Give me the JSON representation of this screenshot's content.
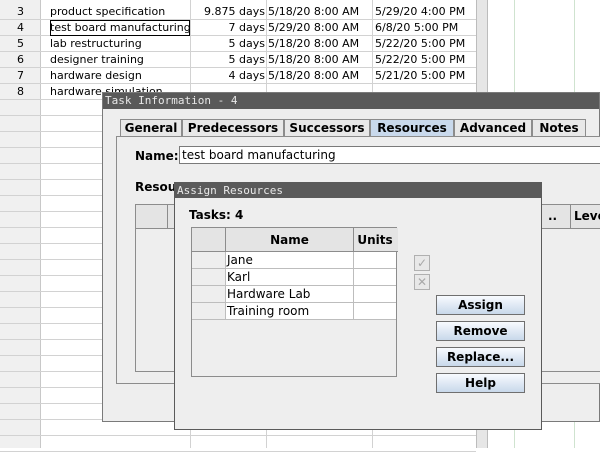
{
  "task_table": {
    "rows": [
      {
        "num": "3",
        "name": "product specification",
        "duration": "9.875 days",
        "start": "5/18/20 8:00 AM",
        "finish": "5/29/20 4:00 PM"
      },
      {
        "num": "4",
        "name": "test board manufacturing",
        "duration": "7 days",
        "start": "5/29/20 8:00 AM",
        "finish": "6/8/20 5:00 PM"
      },
      {
        "num": "5",
        "name": "lab restructuring",
        "duration": "5 days",
        "start": "5/18/20 8:00 AM",
        "finish": "5/22/20 5:00 PM"
      },
      {
        "num": "6",
        "name": "designer training",
        "duration": "5 days",
        "start": "5/18/20 8:00 AM",
        "finish": "5/22/20 5:00 PM"
      },
      {
        "num": "7",
        "name": "hardware design",
        "duration": "4 days",
        "start": "5/18/20 8:00 AM",
        "finish": "5/21/20 5:00 PM"
      },
      {
        "num": "8",
        "name": "hardware simulation",
        "duration": "",
        "start": "",
        "finish": ""
      }
    ]
  },
  "task_info_dialog": {
    "title": "Task Information - 4",
    "tabs": [
      {
        "label": "General"
      },
      {
        "label": "Predecessors"
      },
      {
        "label": "Successors"
      },
      {
        "label": "Resources"
      },
      {
        "label": "Advanced"
      },
      {
        "label": "Notes"
      }
    ],
    "active_tab": "Resources",
    "name_label": "Name:",
    "name_value": "test board manufacturing",
    "resources_label": "Resou",
    "table_header_partial": "..",
    "table_header_leveling": "Leveli"
  },
  "assign_dialog": {
    "title": "Assign Resources",
    "tasks_label": "Tasks: 4",
    "columns": {
      "name": "Name",
      "units": "Units"
    },
    "resources": [
      {
        "name": "Jane",
        "units": ""
      },
      {
        "name": "Karl",
        "units": ""
      },
      {
        "name": "Hardware Lab",
        "units": ""
      },
      {
        "name": "Training room",
        "units": ""
      }
    ],
    "buttons": {
      "assign": "Assign",
      "remove": "Remove",
      "replace": "Replace...",
      "help": "Help"
    },
    "icons": {
      "check": "check-icon",
      "delete": "delete-icon"
    }
  }
}
